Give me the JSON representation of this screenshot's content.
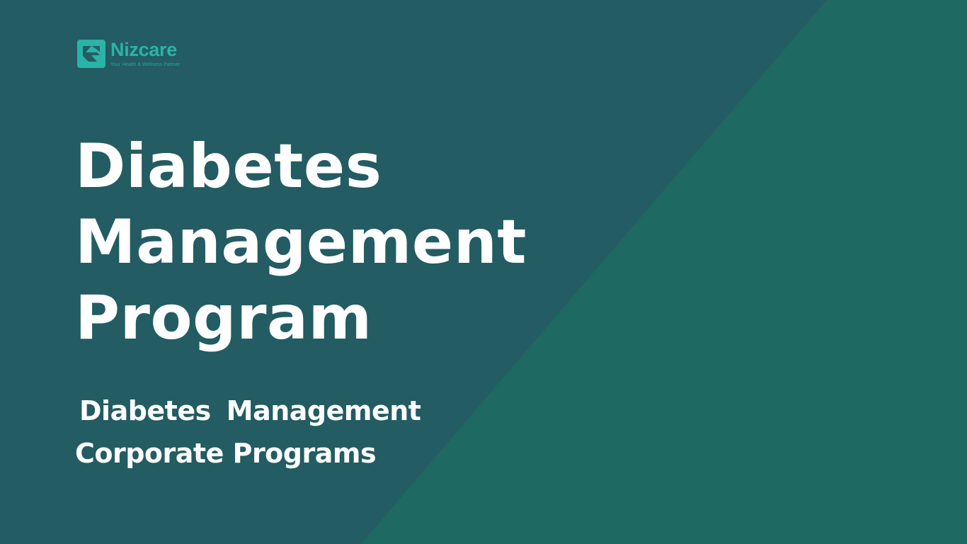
{
  "brand": {
    "name": "Nizcare",
    "tagline": "Your Health & Wellness Partner",
    "accent_color": "#2ab3a6",
    "logo_icon": "nizcare-logo-icon"
  },
  "slide": {
    "title_lines": [
      "Diabetes",
      "Management",
      "Program"
    ],
    "subtitle": {
      "line1_word1": "Diabetes",
      "line1_word2": "Management",
      "line2": "Corporate Programs"
    }
  },
  "colors": {
    "background_dark": "#235c63",
    "background_light": "#1f6963",
    "text": "#ffffff"
  }
}
